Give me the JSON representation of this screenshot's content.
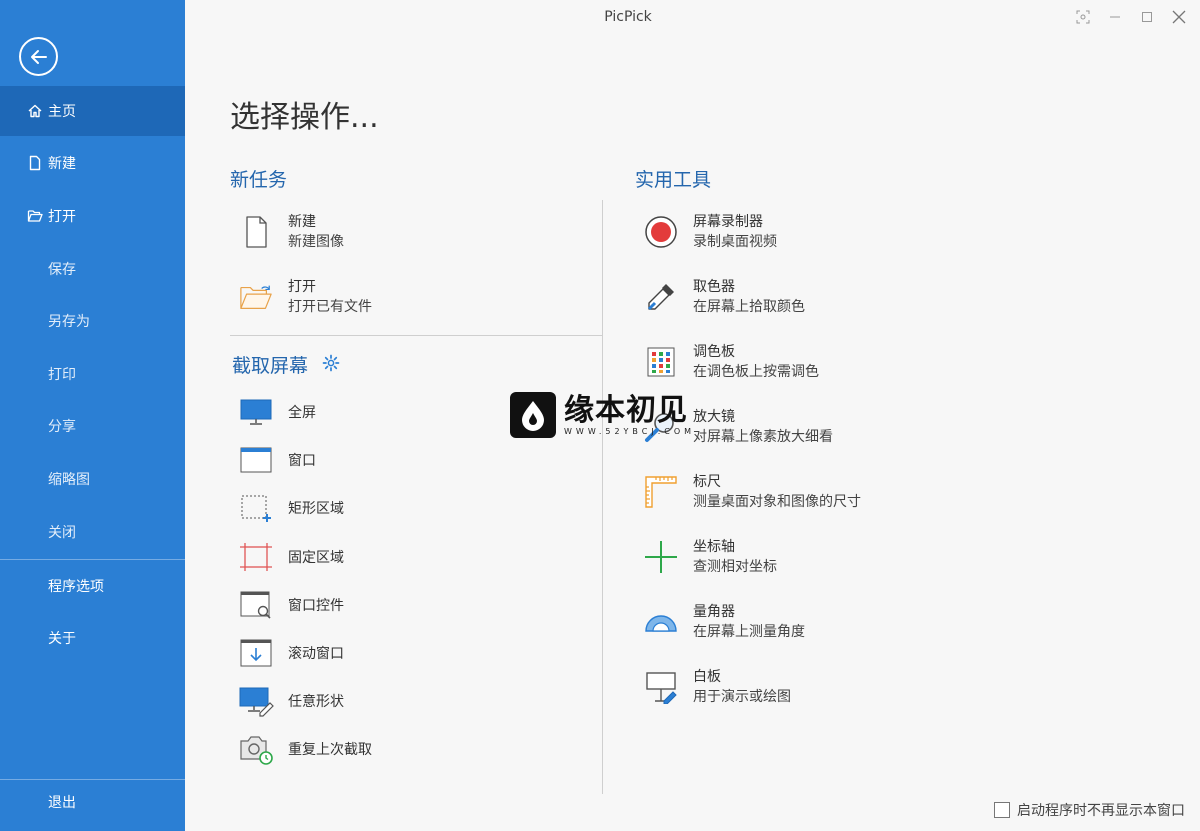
{
  "app_title": "PicPick",
  "sidebar": {
    "items": [
      {
        "label": "主页",
        "icon": "home-icon"
      },
      {
        "label": "新建",
        "icon": "new-file-icon"
      },
      {
        "label": "打开",
        "icon": "folder-open-icon"
      },
      {
        "label": "保存"
      },
      {
        "label": "另存为"
      },
      {
        "label": "打印"
      },
      {
        "label": "分享"
      },
      {
        "label": "缩略图"
      },
      {
        "label": "关闭"
      },
      {
        "label": "程序选项"
      },
      {
        "label": "关于"
      },
      {
        "label": "退出"
      }
    ]
  },
  "main": {
    "title": "选择操作...",
    "new_task": {
      "heading": "新任务",
      "items": [
        {
          "title": "新建",
          "desc": "新建图像"
        },
        {
          "title": "打开",
          "desc": "打开已有文件"
        }
      ]
    },
    "capture": {
      "heading": "截取屏幕",
      "items": [
        {
          "title": "全屏"
        },
        {
          "title": "窗口"
        },
        {
          "title": "矩形区域"
        },
        {
          "title": "固定区域"
        },
        {
          "title": "窗口控件"
        },
        {
          "title": "滚动窗口"
        },
        {
          "title": "任意形状"
        },
        {
          "title": "重复上次截取"
        }
      ]
    },
    "tools": {
      "heading": "实用工具",
      "items": [
        {
          "title": "屏幕录制器",
          "desc": "录制桌面视频"
        },
        {
          "title": "取色器",
          "desc": "在屏幕上拾取颜色"
        },
        {
          "title": "调色板",
          "desc": "在调色板上按需调色"
        },
        {
          "title": "放大镜",
          "desc": "对屏幕上像素放大细看"
        },
        {
          "title": "标尺",
          "desc": "测量桌面对象和图像的尺寸"
        },
        {
          "title": "坐标轴",
          "desc": "查测相对坐标"
        },
        {
          "title": "量角器",
          "desc": "在屏幕上测量角度"
        },
        {
          "title": "白板",
          "desc": "用于演示或绘图"
        }
      ]
    }
  },
  "watermark": {
    "cn": "缘本初见",
    "en": "WWW.52YBCJ.COM"
  },
  "footer": {
    "startup_label": "启动程序时不再显示本窗口"
  },
  "colors": {
    "sidebar": "#2b7fd4",
    "sidebar_active": "#1e68b7",
    "accent_text": "#2466ad"
  }
}
